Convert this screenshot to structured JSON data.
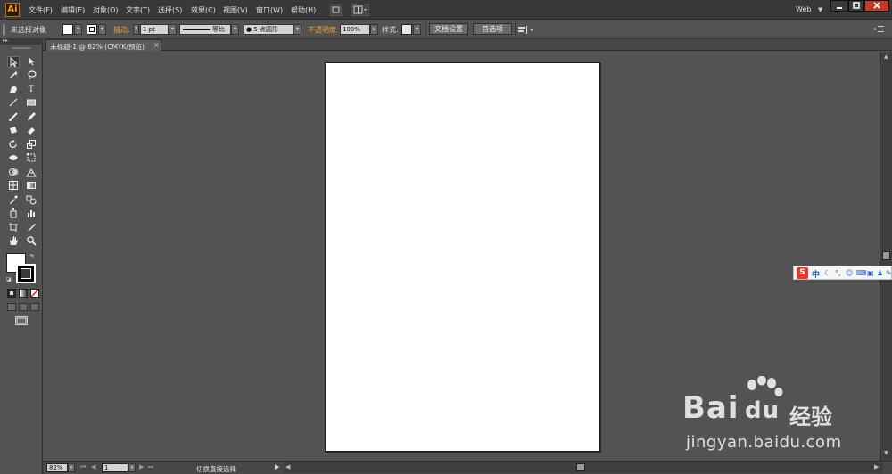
{
  "app": {
    "logo": "Ai",
    "workspace": "Web"
  },
  "menu": [
    "文件(F)",
    "编辑(E)",
    "对象(O)",
    "文字(T)",
    "选择(S)",
    "效果(C)",
    "视图(V)",
    "窗口(W)",
    "帮助(H)"
  ],
  "controlbar": {
    "selection_status": "未选择对象",
    "stroke_label": "描边:",
    "stroke_weight": "1 pt",
    "stroke_profile": "等比",
    "brush": "5 点圆形",
    "opacity_label": "不透明度",
    "opacity_value": "100%",
    "style_label": "样式:",
    "doc_setup_button": "文档设置",
    "preferences_button": "首选项"
  },
  "document_tab": {
    "title": "未标题-1 @ 82% (CMYK/预览)",
    "close": "×"
  },
  "statusbar": {
    "zoom": "82%",
    "artboard": "1",
    "tool_status": "切换直接选择"
  },
  "ime": {
    "mode": "中"
  },
  "watermark": {
    "line1": "Bai",
    "line1b": "du",
    "cn": "经验",
    "url": "jingyan.baidu.com"
  },
  "colors": {
    "accent_orange": "#f0a030",
    "panel": "#535353",
    "menubar": "#383838",
    "artboard": "#ffffff"
  }
}
